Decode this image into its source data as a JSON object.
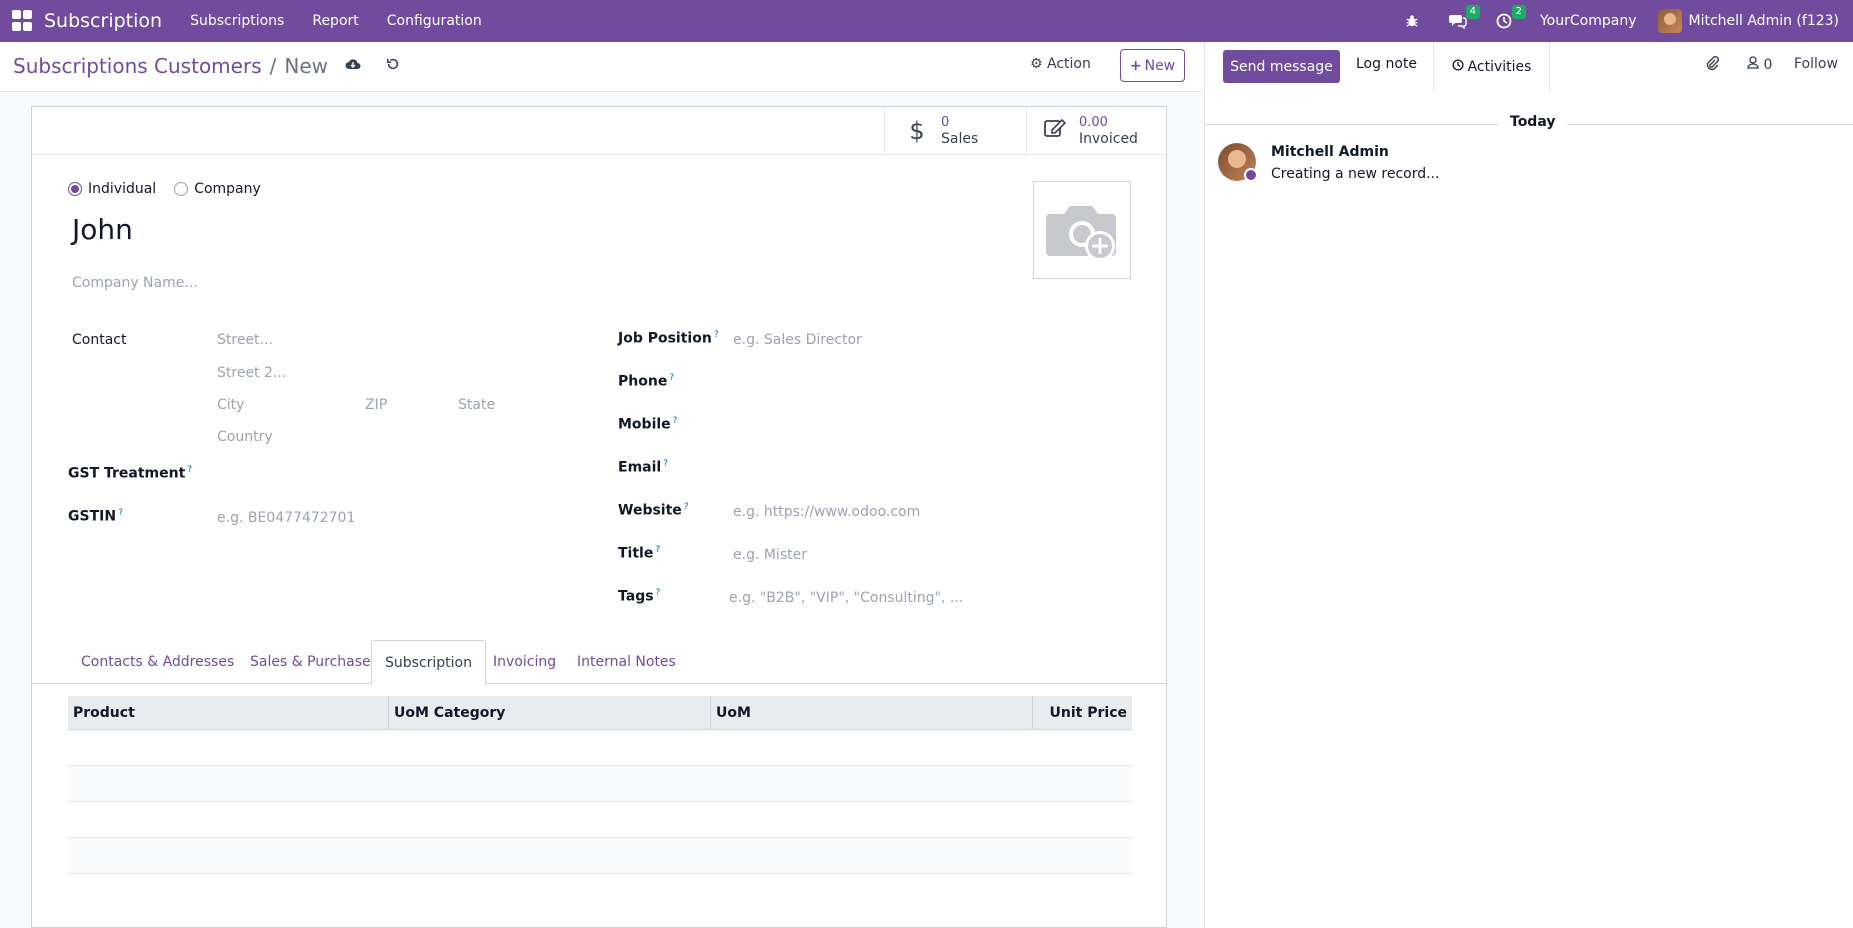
{
  "navbar": {
    "app_title": "Subscription",
    "menus": [
      "Subscriptions",
      "Report",
      "Configuration"
    ],
    "messages_badge": "4",
    "activities_badge": "2",
    "company": "YourCompany",
    "user": "Mitchell Admin (f123)",
    "icons": [
      "apps-grid-icon",
      "bug-icon",
      "chat-icon",
      "clock-icon"
    ],
    "brand_color": "#714b9e"
  },
  "control": {
    "breadcrumb_parent": "Subscriptions Customers",
    "breadcrumb_sep": "/",
    "breadcrumb_current": "New",
    "action_label": "Action",
    "new_label": "New"
  },
  "stats": {
    "sales_value": "0",
    "sales_label": "Sales",
    "invoiced_value": "0.00",
    "invoiced_label": "Invoiced"
  },
  "form": {
    "type_individual": "Individual",
    "type_company": "Company",
    "selected_type": "Individual",
    "name": "John",
    "company_name_placeholder": "Company Name...",
    "contact_label": "Contact",
    "street_ph": "Street...",
    "street2_ph": "Street 2...",
    "city_ph": "City",
    "zip_ph": "ZIP",
    "state_ph": "State",
    "country_ph": "Country",
    "gst_treatment_label": "GST Treatment",
    "gstin_label": "GSTIN",
    "gstin_ph": "e.g. BE0477472701",
    "job_position_label": "Job Position",
    "job_position_ph": "e.g. Sales Director",
    "phone_label": "Phone",
    "mobile_label": "Mobile",
    "email_label": "Email",
    "website_label": "Website",
    "website_ph": "e.g. https://www.odoo.com",
    "title_label": "Title",
    "title_ph": "e.g. Mister",
    "tags_label": "Tags",
    "tags_ph": "e.g. \"B2B\", \"VIP\", \"Consulting\", ...",
    "help_mark": "?"
  },
  "tabs": {
    "items": [
      "Contacts & Addresses",
      "Sales & Purchase",
      "Subscription",
      "Invoicing",
      "Internal Notes"
    ],
    "active": "Subscription"
  },
  "table": {
    "headers": [
      "Product",
      "UoM Category",
      "UoM",
      "Unit Price"
    ]
  },
  "chatter": {
    "send_message": "Send message",
    "log_note": "Log note",
    "activities": "Activities",
    "followers_count": "0",
    "follow": "Follow",
    "today": "Today",
    "author": "Mitchell Admin",
    "body": "Creating a new record..."
  }
}
